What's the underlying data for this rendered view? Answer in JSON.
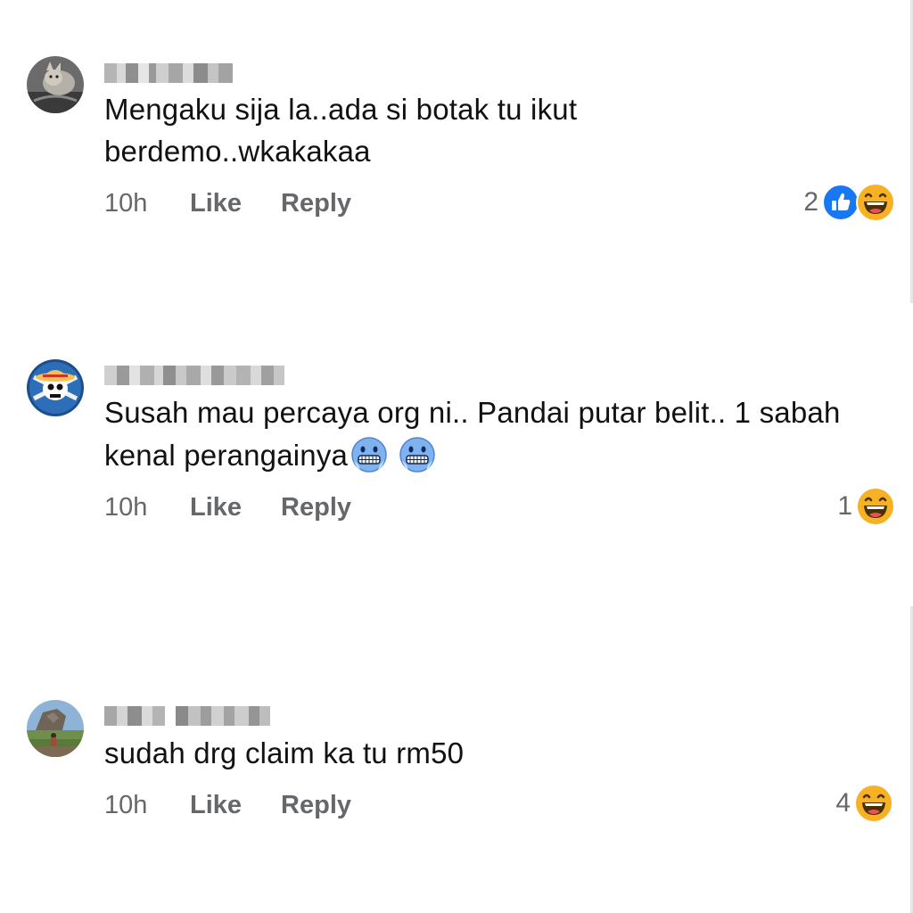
{
  "comments": [
    {
      "text_lines": [
        "Mengaku sija la..ada si botak tu ikut",
        "berdemo..wkakakaa"
      ],
      "time": "10h",
      "like_label": "Like",
      "reply_label": "Reply",
      "reaction_count": "2",
      "reactions": [
        "like-icon",
        "laugh-emoji-icon"
      ]
    },
    {
      "text_lines": [
        "Susah mau percaya org ni.. Pandai putar belit.. 1 sabah",
        "kenal perangainya"
      ],
      "time": "10h",
      "like_label": "Like",
      "reply_label": "Reply",
      "reaction_count": "1",
      "reactions": [
        "laugh-emoji-icon"
      ]
    },
    {
      "text_lines": [
        "sudah drg claim ka tu rm50"
      ],
      "time": "10h",
      "like_label": "Like",
      "reply_label": "Reply",
      "reaction_count": "4",
      "reactions": [
        "laugh-emoji-icon"
      ]
    }
  ],
  "colors": {
    "secondary_text": "#65676b",
    "like_blue": "#1877f2",
    "emoji_yellow": "#f7b125"
  }
}
